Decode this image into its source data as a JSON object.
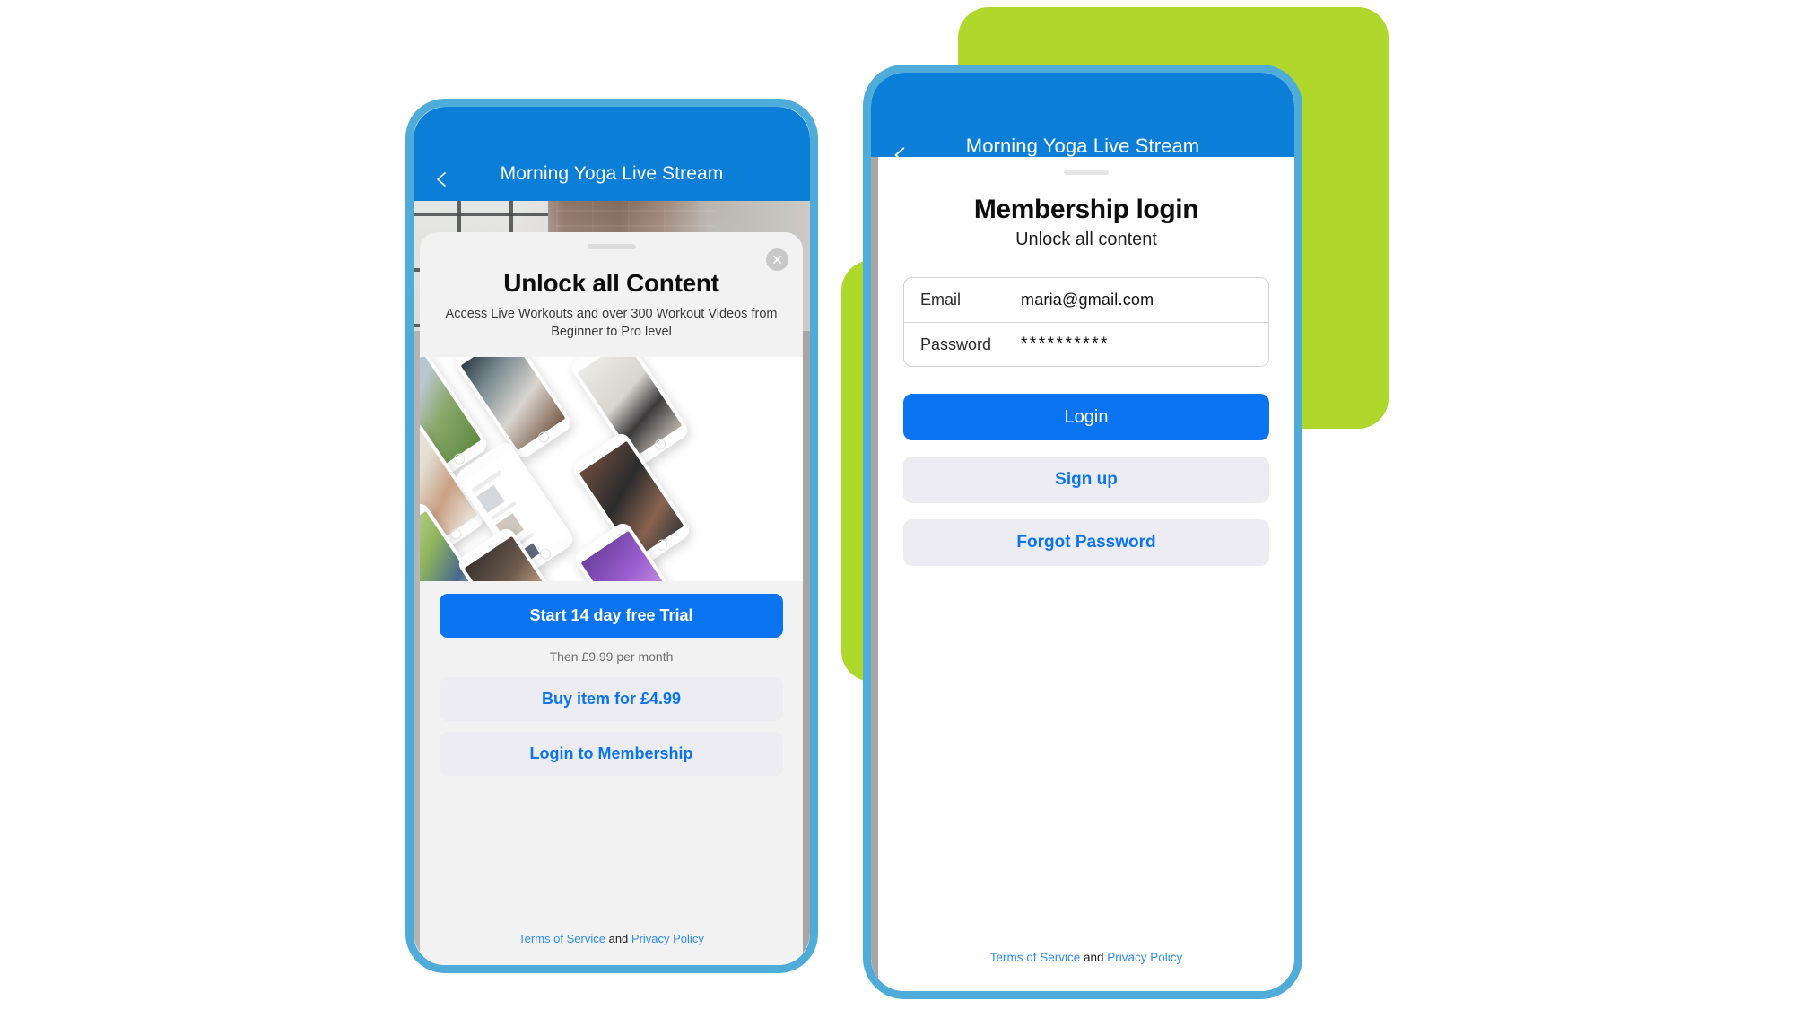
{
  "colors": {
    "header_blue": "#0b7fd8",
    "phone_border": "#4facd8",
    "accent_green": "#b0d72b",
    "button_blue": "#0a74f0",
    "link_blue": "#2d8cf0",
    "secondary_button_bg": "#ececf2",
    "sheet_bg": "#f2f2f2"
  },
  "left_phone": {
    "navbar": {
      "title": "Morning Yoga Live Stream",
      "back_icon": "chevron-left-icon"
    },
    "hero": {
      "alt": "gym-workout-video-still"
    },
    "sheet": {
      "close_icon": "close-icon",
      "title": "Unlock all Content",
      "subtitle": "Access Live Workouts and over 300 Workout Videos from Beginner to Pro level"
    },
    "cta": {
      "trial_button": "Start 14 day free Trial",
      "price_note": "Then £9.99 per month",
      "buy_button": "Buy item for £4.99",
      "login_button": "Login to Membership"
    },
    "legal": {
      "terms": "Terms of Service",
      "conjunction": "and",
      "privacy": "Privacy Policy"
    }
  },
  "right_phone": {
    "navbar": {
      "title": "Morning Yoga Live Stream",
      "back_icon": "chevron-left-icon"
    },
    "hero": {
      "alt": "gym-workout-video-still"
    },
    "form": {
      "title": "Membership login",
      "subtitle": "Unlock all content",
      "email_label": "Email",
      "email_value": "maria@gmail.com",
      "email_placeholder": "Email",
      "password_label": "Password",
      "password_value": "**********",
      "password_placeholder": "Password"
    },
    "actions": {
      "login_button": "Login",
      "signup_button": "Sign up",
      "forgot_button": "Forgot Password"
    },
    "legal": {
      "terms": "Terms of Service",
      "conjunction": "and",
      "privacy": "Privacy Policy"
    }
  }
}
